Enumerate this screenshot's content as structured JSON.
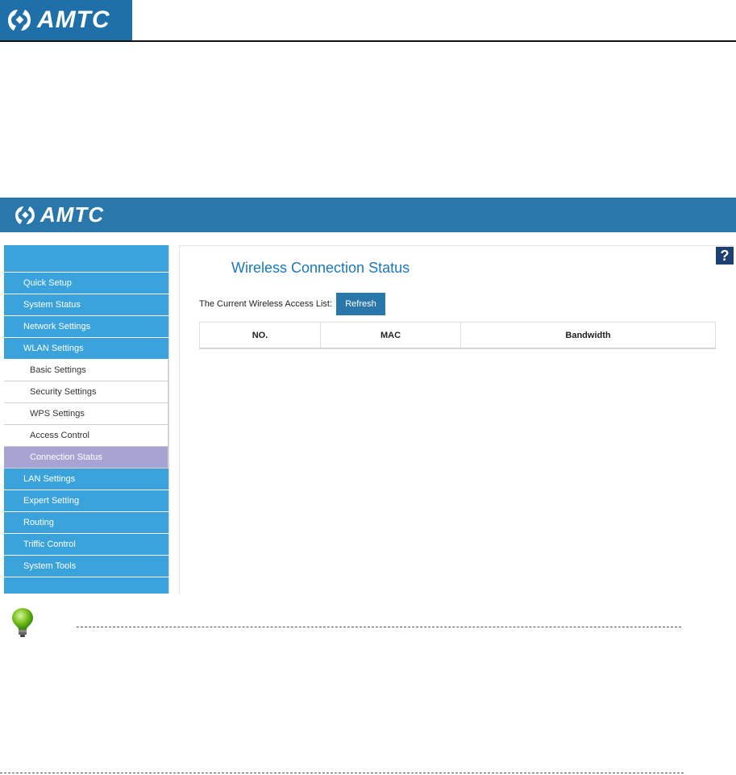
{
  "brand": {
    "name": "AMTC"
  },
  "router": {
    "sidebar": {
      "items": [
        {
          "label": "Quick Setup",
          "level": "top"
        },
        {
          "label": "System Status",
          "level": "top"
        },
        {
          "label": "Network Settings",
          "level": "top"
        },
        {
          "label": "WLAN Settings",
          "level": "top"
        },
        {
          "label": "Basic Settings",
          "level": "sub"
        },
        {
          "label": "Security Settings",
          "level": "sub"
        },
        {
          "label": "WPS Settings",
          "level": "sub"
        },
        {
          "label": "Access Control",
          "level": "sub"
        },
        {
          "label": "Connection Status",
          "level": "sub",
          "active": true
        },
        {
          "label": "LAN Settings",
          "level": "top"
        },
        {
          "label": "Expert Setting",
          "level": "top"
        },
        {
          "label": "Routing",
          "level": "top"
        },
        {
          "label": "Triffic Control",
          "level": "top"
        },
        {
          "label": "System Tools",
          "level": "top"
        }
      ]
    },
    "page_title": "Wireless Connection Status",
    "help_label": "?",
    "list_label": "The Current Wireless Access List:",
    "refresh_label": "Refresh",
    "table": {
      "columns": [
        "NO.",
        "MAC",
        "Bandwidth"
      ],
      "rows": []
    }
  },
  "colors": {
    "banner": "#2a77ab",
    "sidebar": "#3aa3dc",
    "active_item": "#a9a3d4",
    "title": "#1a78bd",
    "help": "#1d3f72"
  }
}
